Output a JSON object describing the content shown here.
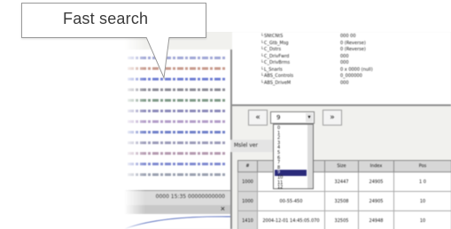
{
  "callout": {
    "label": "Fast search"
  },
  "wave_panel": {
    "footer_text": "0000 15:35 00000000000",
    "row_colors": [
      "#a0a7d6",
      "#c79a8d",
      "#6f7ed2",
      "#8c8c96",
      "#7f9a88",
      "#8a88b8",
      "#b39dc8",
      "#6f7fc9",
      "#9b9bb8",
      "#b59ab0",
      "#7f8ad0",
      "#9aa0b0"
    ]
  },
  "bottom_panel": {
    "close_label": "×"
  },
  "tree": {
    "rows": [
      {
        "key": "SNtCNtS",
        "value": "000 00"
      },
      {
        "key": "C_Gtb_Msg",
        "value": "0 (Reverse)"
      },
      {
        "key": "C_Dstrs",
        "value": "0 (Reverse)"
      },
      {
        "key": "C_DrivFwrd",
        "value": "000"
      },
      {
        "key": "C_DrivBrms",
        "value": "000"
      },
      {
        "key": "L_Snarls",
        "value": "0 x 0000 (null)"
      },
      {
        "key": "ABS_Controls",
        "value": "0_000000"
      },
      {
        "key": "ABS_DriveM",
        "value": "000"
      }
    ]
  },
  "nav": {
    "prev_label": "«",
    "next_label": "»"
  },
  "select": {
    "current": "9",
    "arrow": "▾",
    "options": [
      "0",
      "1",
      "2",
      "3",
      "4",
      "5",
      "6",
      "7",
      "8",
      "9",
      "10",
      "11",
      "12"
    ],
    "selected_index": 9
  },
  "status": {
    "text": "Mslel ver"
  },
  "table": {
    "headers": [
      "#",
      "",
      "Size",
      "Index",
      "Pos"
    ],
    "rows": [
      [
        "1000",
        "00-07-050",
        "32447",
        "24905",
        "1 0"
      ],
      [
        "1000",
        "00-55-450",
        "32508",
        "24905",
        "10"
      ],
      [
        "1410",
        "2004-12-01 14:45:05.070",
        "32505",
        "24948",
        "10"
      ]
    ]
  }
}
